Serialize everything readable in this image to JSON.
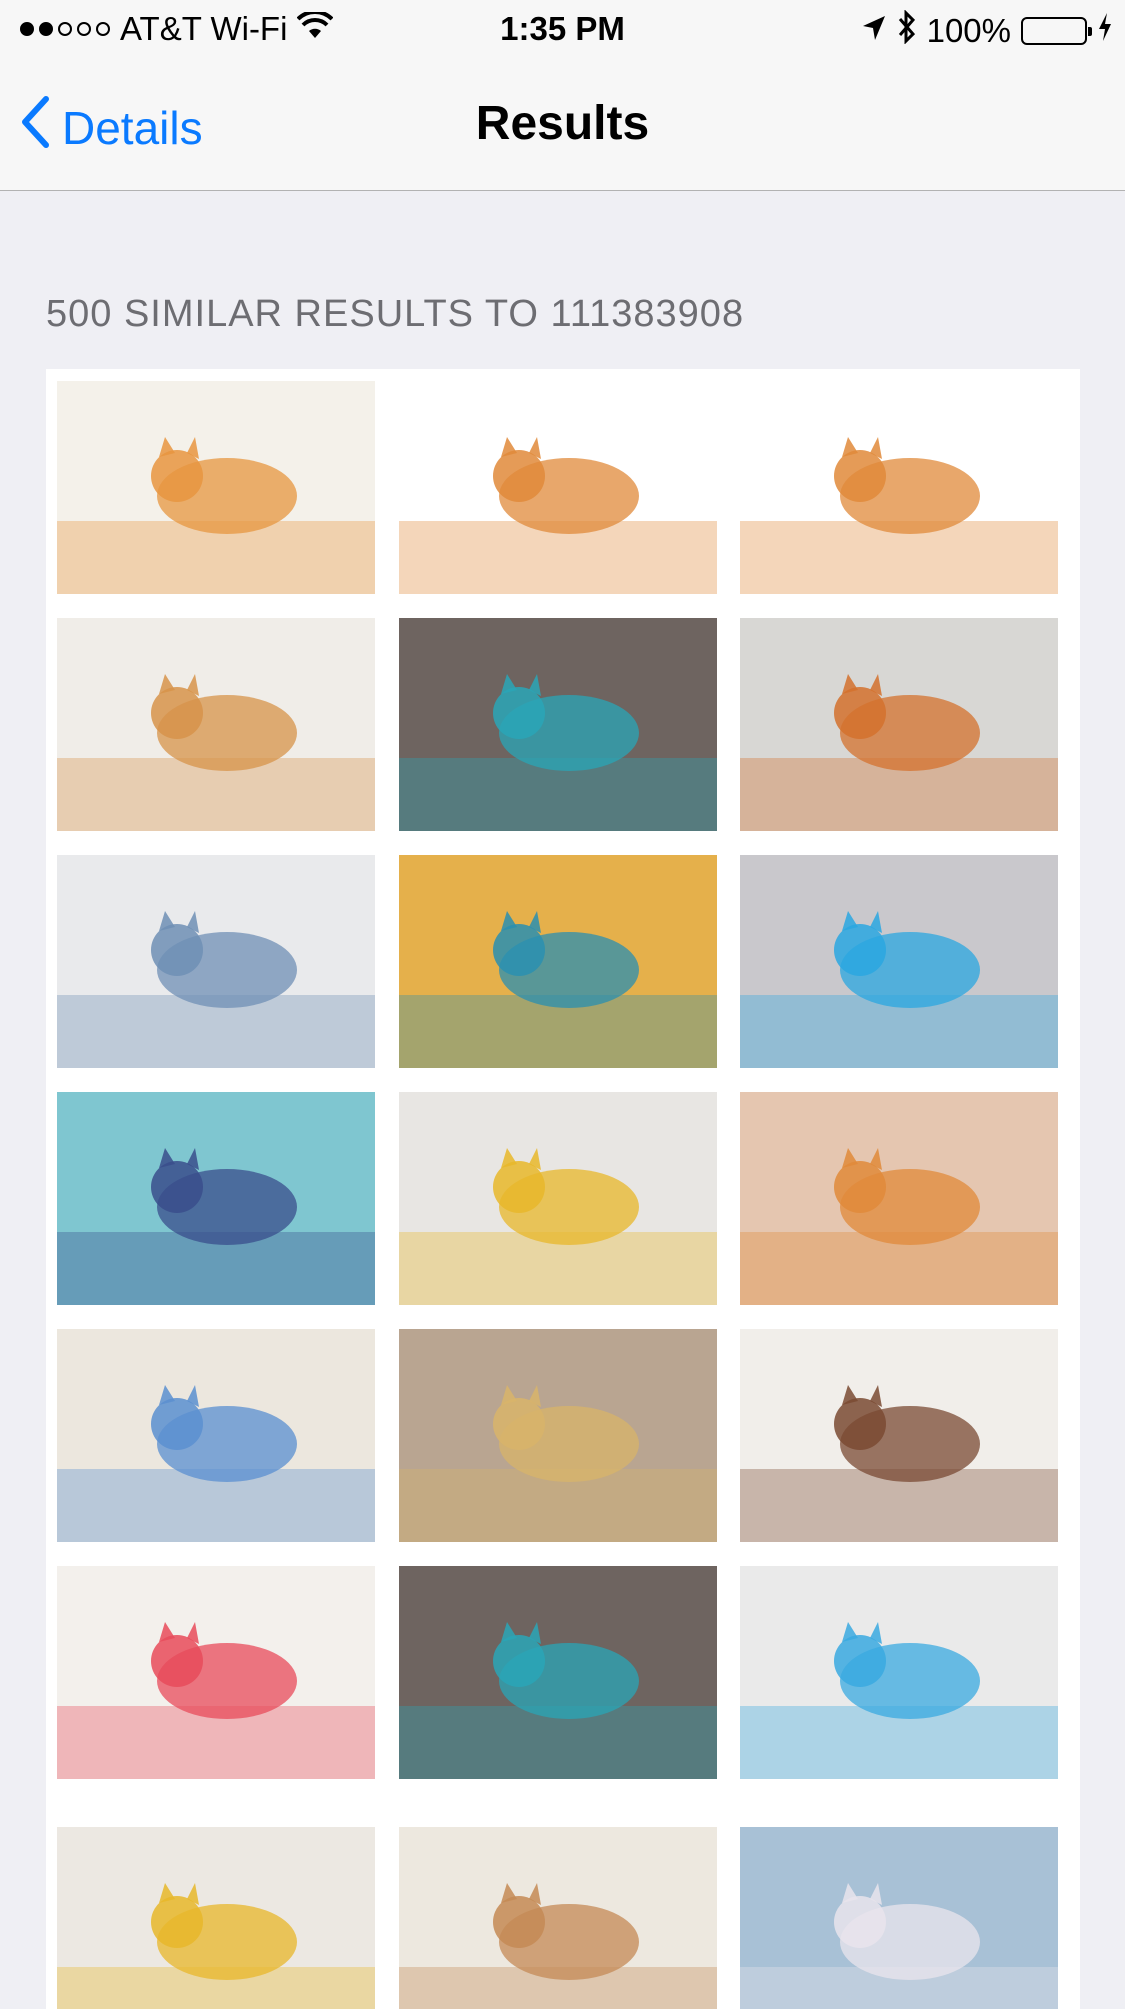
{
  "status_bar": {
    "carrier": "AT&T Wi-Fi",
    "time": "1:35 PM",
    "battery": "100%",
    "signal_dots_filled": 2,
    "signal_dots_total": 5,
    "battery_color": "#4cd964"
  },
  "nav": {
    "back_label": "Details",
    "title": "Results",
    "accent_color": "#0a7aff"
  },
  "results": {
    "header": "500 SIMILAR RESULTS TO 111383908",
    "thumbnails": [
      {
        "name": "kitten-in-towels",
        "bg": "#f4f1ea",
        "accent": "#e7953f"
      },
      {
        "name": "kitten-on-towel-stack",
        "bg": "#ffffff",
        "accent": "#e08a3a"
      },
      {
        "name": "kitten-on-towel-stack-2",
        "bg": "#ffffff",
        "accent": "#e08a3a"
      },
      {
        "name": "kitten-in-basket",
        "bg": "#f0ede8",
        "accent": "#d7934a"
      },
      {
        "name": "cat-on-blue-cloth",
        "bg": "#6e6460",
        "accent": "#2aa6b7"
      },
      {
        "name": "man-with-cat",
        "bg": "#d8d7d4",
        "accent": "#d4712d"
      },
      {
        "name": "girl-feeding-cat",
        "bg": "#e9eaec",
        "accent": "#6f8fb5"
      },
      {
        "name": "white-kitten-yarn",
        "bg": "#e5b04b",
        "accent": "#2a8fb0"
      },
      {
        "name": "cat-in-sweater",
        "bg": "#c9c8cc",
        "accent": "#2aa7e0"
      },
      {
        "name": "kitten-held-by-hand",
        "bg": "#7fc6d0",
        "accent": "#3a4d8c"
      },
      {
        "name": "kitten-on-plaid-blanket",
        "bg": "#e8e6e3",
        "accent": "#e8b72a"
      },
      {
        "name": "ginger-cat-flowers",
        "bg": "#e5c6b0",
        "accent": "#e08a3a"
      },
      {
        "name": "kitten-in-blanket",
        "bg": "#ece7de",
        "accent": "#5a8fd0"
      },
      {
        "name": "tabby-playing-toy",
        "bg": "#b9a591",
        "accent": "#d8b46a"
      },
      {
        "name": "woman-sleeping-kitten",
        "bg": "#f1eeea",
        "accent": "#7a4a33"
      },
      {
        "name": "tabby-on-colorful-rug",
        "bg": "#f3f0ec",
        "accent": "#e84b5b"
      },
      {
        "name": "cat-rolling-blue-cloth",
        "bg": "#6e6460",
        "accent": "#2aa6b7"
      },
      {
        "name": "tabby-on-blue-bed",
        "bg": "#eaeaea",
        "accent": "#3aa9e0"
      },
      {
        "name": "kitten-plaid-blanket-2",
        "bg": "#ece8e2",
        "accent": "#e8b72a"
      },
      {
        "name": "kitten-in-white-blanket",
        "bg": "#ede8df",
        "accent": "#c48a55"
      },
      {
        "name": "cat-with-yarn-ball",
        "bg": "#a8c1d6",
        "accent": "#e9e4ec"
      }
    ]
  }
}
